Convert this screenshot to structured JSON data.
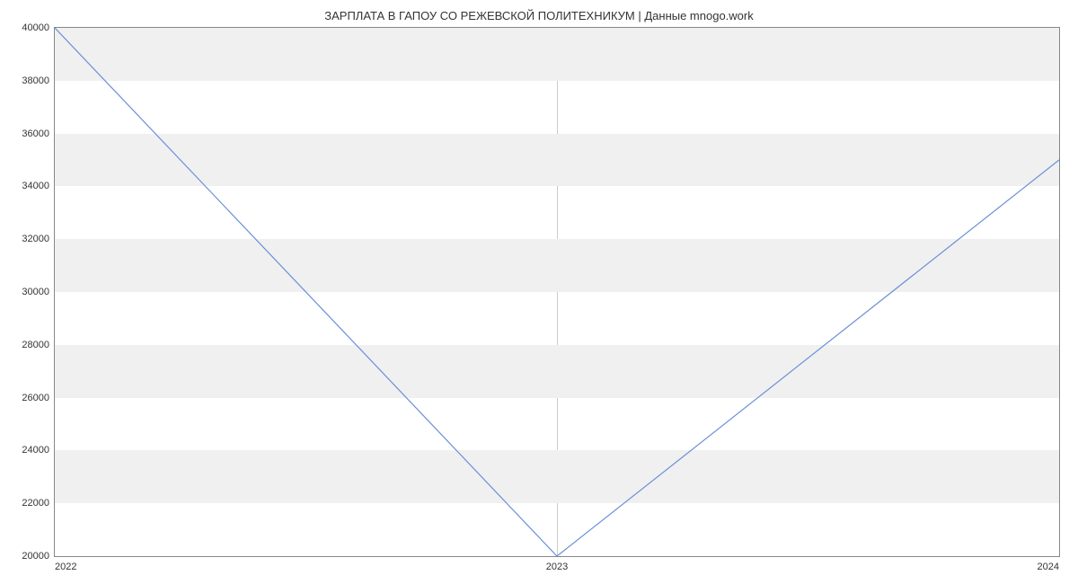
{
  "chart_data": {
    "type": "line",
    "title": "ЗАРПЛАТА В ГАПОУ СО РЕЖЕВСКОЙ ПОЛИТЕХНИКУМ | Данные mnogo.work",
    "x": [
      2022,
      2023,
      2024
    ],
    "values": [
      40000,
      20000,
      35000
    ],
    "xlabel": "",
    "ylabel": "",
    "ylim": [
      20000,
      40000
    ],
    "xlim": [
      2022,
      2024
    ],
    "y_ticks": [
      20000,
      22000,
      24000,
      26000,
      28000,
      30000,
      32000,
      34000,
      36000,
      38000,
      40000
    ],
    "x_ticks": [
      2022,
      2023,
      2024
    ],
    "line_color": "#6a8fd8"
  }
}
